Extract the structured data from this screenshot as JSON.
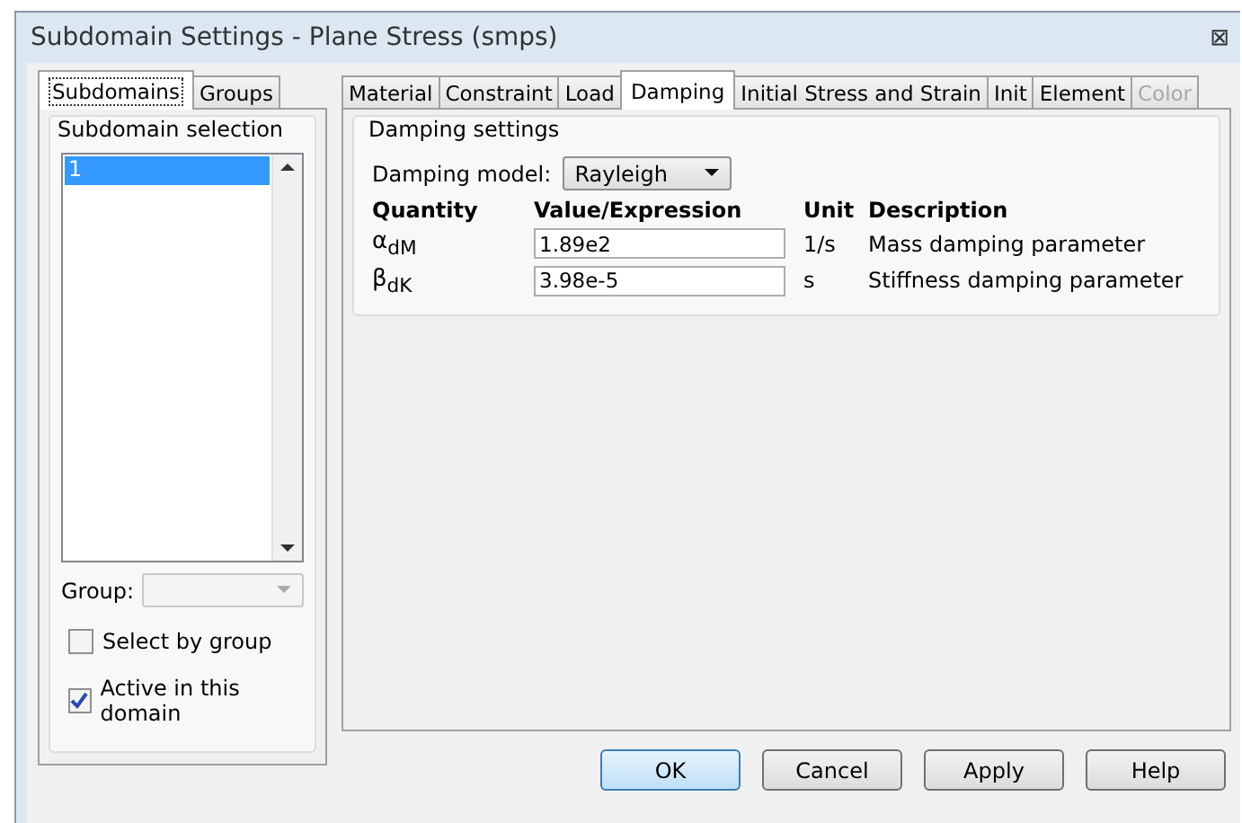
{
  "window": {
    "title": "Subdomain Settings - Plane Stress (smps)",
    "close": "⊠"
  },
  "left_tabs": [
    {
      "label": "Subdomains",
      "selected": true
    },
    {
      "label": "Groups",
      "selected": false
    }
  ],
  "subdomain_selection": {
    "title": "Subdomain selection",
    "items": [
      {
        "label": "1",
        "selected": true
      }
    ],
    "group_label": "Group:",
    "checkboxes": [
      {
        "label": "Select by group",
        "checked": false
      },
      {
        "label": "Active in this domain",
        "checked": true
      }
    ]
  },
  "tabs": [
    {
      "label": "Material",
      "selected": false,
      "disabled": false
    },
    {
      "label": "Constraint",
      "selected": false,
      "disabled": false
    },
    {
      "label": "Load",
      "selected": false,
      "disabled": false
    },
    {
      "label": "Damping",
      "selected": true,
      "disabled": false
    },
    {
      "label": "Initial Stress and Strain",
      "selected": false,
      "disabled": false
    },
    {
      "label": "Init",
      "selected": false,
      "disabled": false
    },
    {
      "label": "Element",
      "selected": false,
      "disabled": false
    },
    {
      "label": "Color",
      "selected": false,
      "disabled": true
    }
  ],
  "damping": {
    "title": "Damping settings",
    "model_label": "Damping model:",
    "model_value": "Rayleigh",
    "columns": [
      "Quantity",
      "Value/Expression",
      "Unit",
      "Description"
    ],
    "rows": [
      {
        "quantity": "α$_{dM}$",
        "value": "1.89e2",
        "unit": "1/s",
        "description": "Mass damping parameter"
      },
      {
        "quantity": "β$_{dK}$",
        "value": "3.98e-5",
        "unit": "s",
        "description": "Stiffness damping parameter"
      }
    ]
  },
  "buttons": [
    {
      "label": "OK",
      "default": true
    },
    {
      "label": "Cancel",
      "default": false
    },
    {
      "label": "Apply",
      "default": false
    },
    {
      "label": "Help",
      "default": false
    }
  ]
}
